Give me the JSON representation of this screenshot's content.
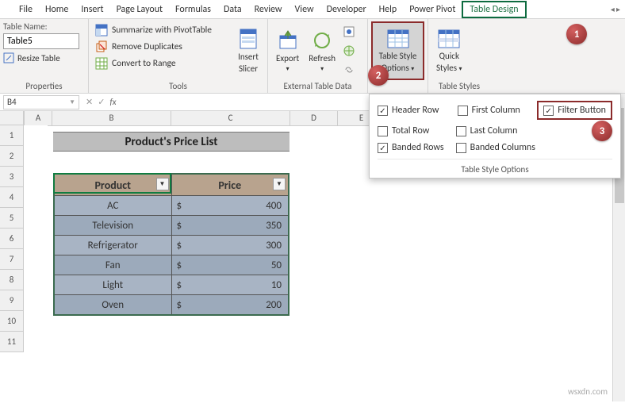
{
  "menu": {
    "tabs": [
      "File",
      "Home",
      "Insert",
      "Page Layout",
      "Formulas",
      "Data",
      "Review",
      "View",
      "Developer",
      "Help",
      "Power Pivot",
      "Table Design"
    ]
  },
  "ribbon": {
    "properties": {
      "label": "Properties",
      "table_name_label": "Table Name:",
      "table_name_value": "Table5",
      "resize": "Resize Table"
    },
    "tools": {
      "label": "Tools",
      "summarize": "Summarize with PivotTable",
      "remove_dup": "Remove Duplicates",
      "convert": "Convert to Range",
      "slicer_line1": "Insert",
      "slicer_line2": "Slicer"
    },
    "external": {
      "label": "External Table Data",
      "export": "Export",
      "refresh": "Refresh"
    },
    "style_opts_btn": {
      "line1": "Table Style",
      "line2": "Options"
    },
    "styles": {
      "label": "Table Styles",
      "quick_line1": "Quick",
      "quick_line2": "Styles"
    }
  },
  "dropdown": {
    "header_row": "Header Row",
    "first_col": "First Column",
    "filter_btn": "Filter Button",
    "total_row": "Total Row",
    "last_col": "Last Column",
    "banded_rows": "Banded Rows",
    "banded_cols": "Banded Columns",
    "group_label": "Table Style Options",
    "check": {
      "header_row": true,
      "first_col": false,
      "filter_btn": true,
      "total_row": false,
      "last_col": false,
      "banded_rows": true,
      "banded_cols": false
    }
  },
  "formula": {
    "cell_ref": "B4",
    "fx": "fx"
  },
  "columns": [
    "A",
    "B",
    "C",
    "D",
    "E"
  ],
  "rows": [
    "1",
    "2",
    "3",
    "4",
    "5",
    "6",
    "7",
    "8",
    "9",
    "10",
    "11"
  ],
  "sheet": {
    "title": "Product's Price List",
    "headers": {
      "product": "Product",
      "price": "Price"
    },
    "currency": "$",
    "data": [
      {
        "product": "AC",
        "price": "400"
      },
      {
        "product": "Television",
        "price": "350"
      },
      {
        "product": "Refrigerator",
        "price": "300"
      },
      {
        "product": "Fan",
        "price": "50"
      },
      {
        "product": "Light",
        "price": "10"
      },
      {
        "product": "Oven",
        "price": "200"
      }
    ]
  },
  "callouts": {
    "c1": "1",
    "c2": "2",
    "c3": "3"
  },
  "watermark": "wsxdn.com"
}
